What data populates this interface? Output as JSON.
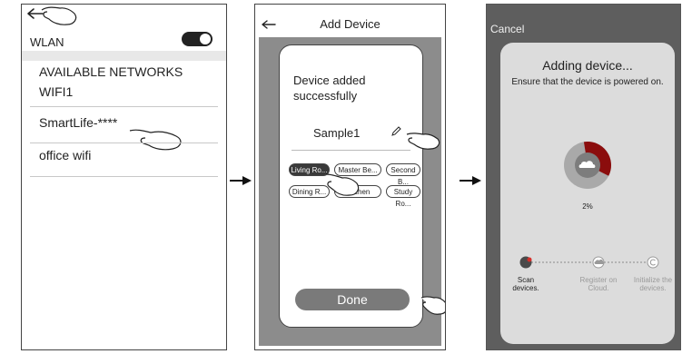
{
  "panel1": {
    "wlan_label": "WLAN",
    "section_header": "AVAILABLE NETWORKS",
    "networks": [
      "WIFI1",
      "SmartLife-****",
      "office wifi"
    ]
  },
  "panel2": {
    "title": "Add Device",
    "success_message_line1": "Device added",
    "success_message_line2": "successfully",
    "device_name": "Sample1",
    "rooms": [
      "Living Ro...",
      "Master Be...",
      "Second B...",
      "Dining R...",
      "Kitchen",
      "Study Ro..."
    ],
    "selected_room": "Living Ro...",
    "done_label": "Done"
  },
  "panel3": {
    "cancel_label": "Cancel",
    "heading": "Adding device...",
    "subtext": "Ensure that the device is powered on.",
    "progress_percent": "2%",
    "progress_value": 0.02,
    "steps": [
      {
        "line1": "Scan",
        "line2": "devices."
      },
      {
        "line1": "Register on",
        "line2": "Cloud."
      },
      {
        "line1": "Initialize the",
        "line2": "devices."
      }
    ]
  },
  "colors": {
    "accent_dark_red": "#8b0d0d",
    "accent_red": "#d6302a",
    "panel_gray": "#5e5e5e"
  }
}
